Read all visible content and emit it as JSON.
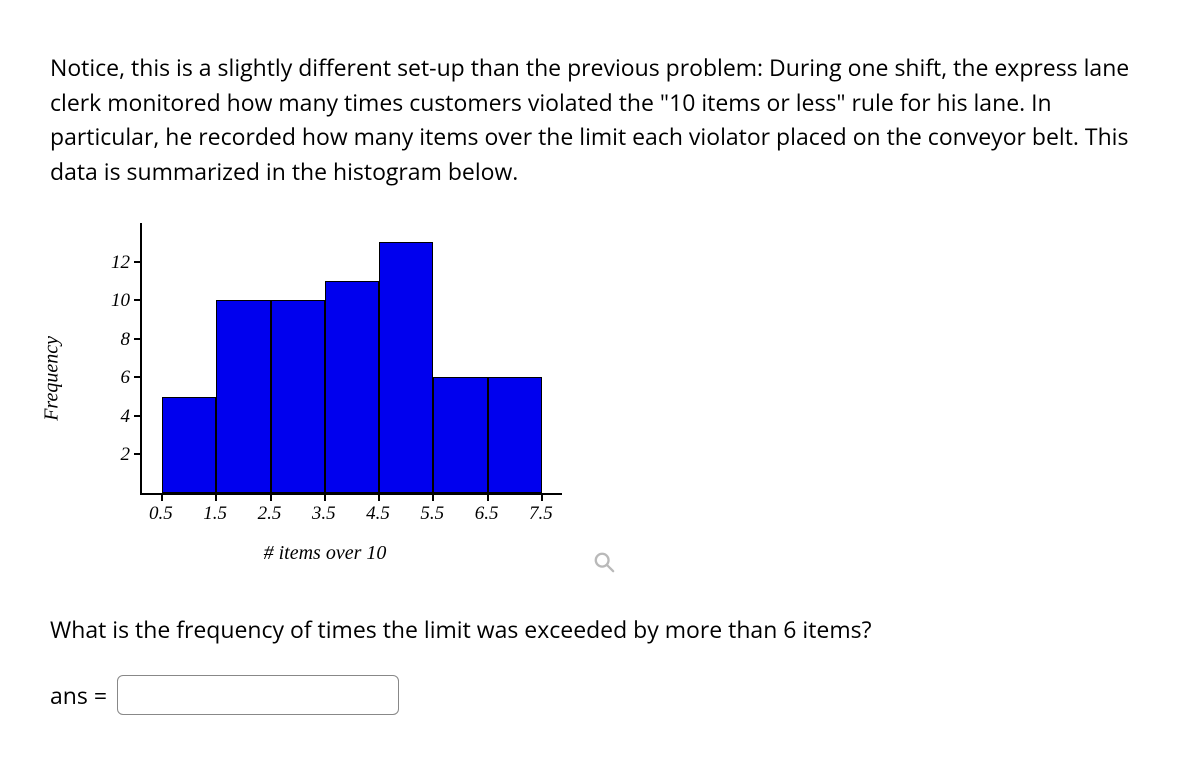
{
  "problem_text": "Notice, this is a slightly different set-up than the previous problem:\nDuring one shift, the express lane clerk monitored how many times customers violated the \"10 items or less\" rule for his lane. In particular, he recorded how many items over the limit each violator placed on the conveyor belt. This data is summarized in the histogram below.",
  "question_text": "What is the frequency of times the limit was exceeded by more than 6 items?",
  "answer_label": "ans =",
  "answer_value": "",
  "chart_data": {
    "type": "bar",
    "title": "",
    "xlabel": "# items over 10",
    "ylabel": "Frequency",
    "bin_edges": [
      0.5,
      1.5,
      2.5,
      3.5,
      4.5,
      5.5,
      6.5,
      7.5
    ],
    "categories": [
      "0.5–1.5",
      "1.5–2.5",
      "2.5–3.5",
      "3.5–4.5",
      "4.5–5.5",
      "5.5–6.5",
      "6.5–7.5"
    ],
    "values": [
      5,
      10,
      10,
      11,
      13,
      6,
      6
    ],
    "yticks": [
      2,
      4,
      6,
      8,
      10,
      12
    ],
    "xticks": [
      "0.5",
      "1.5",
      "2.5",
      "3.5",
      "4.5",
      "5.5",
      "6.5",
      "7.5"
    ],
    "ylim": [
      0,
      14
    ]
  }
}
